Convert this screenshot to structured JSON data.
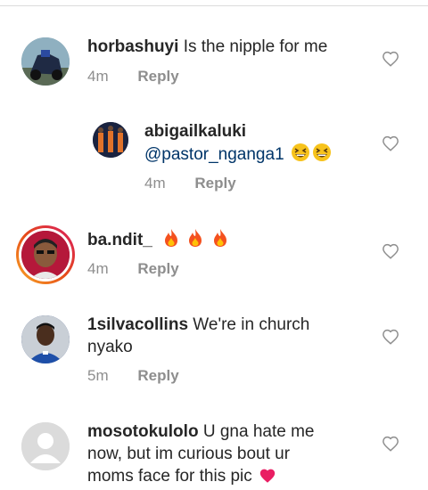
{
  "comments": [
    {
      "username": "horbashuyi",
      "text": "Is the nipple for me",
      "time": "4m",
      "reply": "Reply"
    },
    {
      "username": "abigailkaluki",
      "mention": "@pastor_nganga1",
      "emoji": "grinning-squinting-face x2",
      "time": "4m",
      "reply": "Reply"
    },
    {
      "username": "ba.ndit_",
      "emoji": "fire x3",
      "time": "4m",
      "reply": "Reply"
    },
    {
      "username": "1silvacollins",
      "text_line1": "We're in church",
      "text_line2": "nyako",
      "time": "5m",
      "reply": "Reply"
    },
    {
      "username": "mosotokulolo",
      "text_line1": "U gna hate me",
      "text_line2": "now, but im curious bout ur",
      "text_line3": "moms face for this pic",
      "emoji": "pink-heart"
    }
  ],
  "colors": {
    "username": "#262626",
    "mention": "#003569",
    "meta": "#8e8e8e",
    "story_ring_start": "#f9a825",
    "story_ring_end": "#d81b60"
  }
}
